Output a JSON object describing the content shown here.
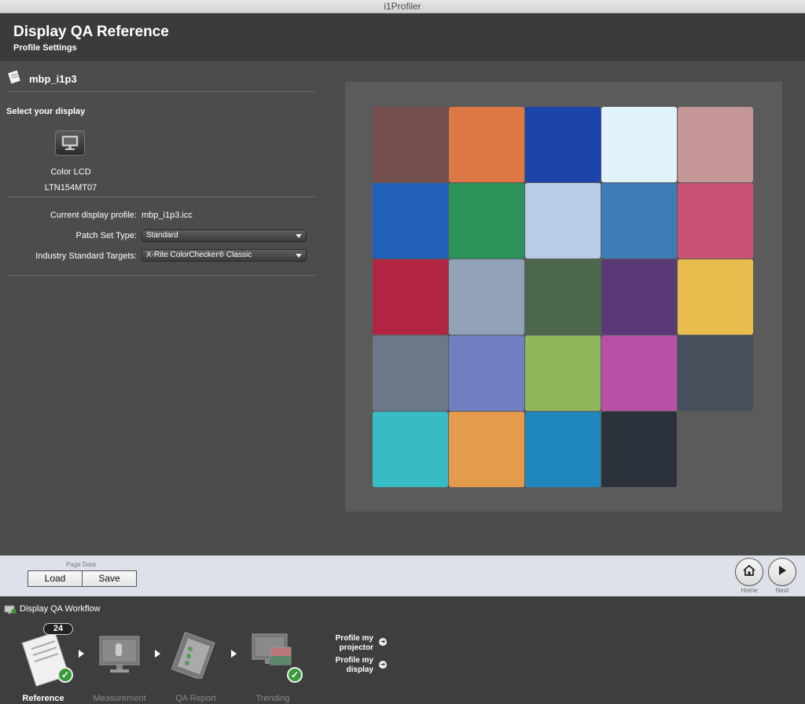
{
  "window": {
    "title": "i1Profiler"
  },
  "header": {
    "title": "Display QA Reference",
    "subtitle": "Profile Settings"
  },
  "profile": {
    "name": "mbp_i1p3"
  },
  "display": {
    "section_label": "Select your display",
    "name_line1": "Color LCD",
    "name_line2": "LTN154MT07"
  },
  "form": {
    "current_profile_label": "Current display profile:",
    "current_profile_value": "mbp_i1p3.icc",
    "patch_set_label": "Patch Set Type:",
    "patch_set_value": "Standard",
    "targets_label": "Industry Standard Targets:",
    "targets_value": "X-Rite ColorChecker® Classic"
  },
  "patches": [
    "#744f4d",
    "#dd7744",
    "#1a44aa",
    "#e0f2fa",
    "#c49696",
    "#2060b8",
    "#2a935a",
    "#b8cce6",
    "#3f7bb7",
    "#cc5177",
    "#b32643",
    "#90a1b8",
    "#4e684e",
    "#593a77",
    "#e8bd4d",
    "#6b7888",
    "#717ec1",
    "#91b659",
    "#b950a8",
    "#474e5c",
    "#37bbc5",
    "#e49b4b",
    "#2188bf",
    "#2b323b"
  ],
  "bottom_bar": {
    "page_data_label": "Page Data",
    "load_label": "Load",
    "save_label": "Save",
    "home_label": "Home",
    "next_label": "Next"
  },
  "workflow": {
    "title": "Display QA Workflow",
    "counter": "24",
    "steps": [
      {
        "label": "Reference"
      },
      {
        "label": "Measurement"
      },
      {
        "label": "QA Report"
      },
      {
        "label": "Trending"
      }
    ],
    "link_projector": "Profile my\nprojector",
    "link_display": "Profile my\ndisplay"
  }
}
